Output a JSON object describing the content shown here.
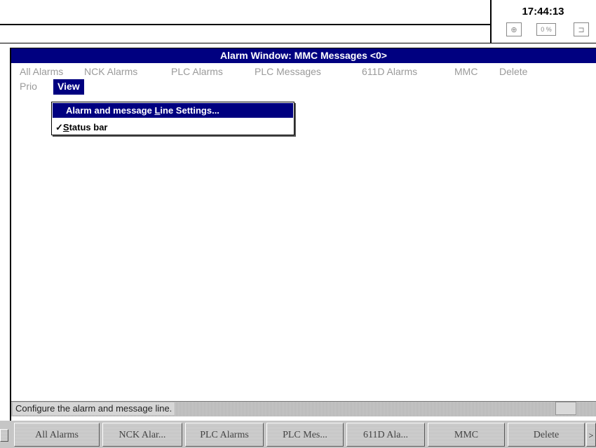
{
  "clock": "17:44:13",
  "header_icons": {
    "left": "⊕",
    "middle": "0 %",
    "right": "⊐"
  },
  "window_title": "Alarm Window: MMC Messages <0>",
  "menu": {
    "row1": [
      "All Alarms",
      "NCK Alarms",
      "PLC Alarms",
      "PLC Messages",
      "611D Alarms",
      "MMC",
      "Delete"
    ],
    "row2": [
      "Prio",
      "View"
    ]
  },
  "dropdown": {
    "item1_pre": "Alarm and message ",
    "item1_ul": "L",
    "item1_post": "ine Settings...",
    "item2_check": "✓",
    "item2_ul": "S",
    "item2_post": "tatus bar"
  },
  "status_text": "Configure the alarm and message line.",
  "softkeys": [
    "All Alarms",
    "NCK Alar...",
    "PLC Alarms",
    "PLC Mes...",
    "611D Ala...",
    "MMC",
    "Delete"
  ],
  "softkey_right": ">"
}
